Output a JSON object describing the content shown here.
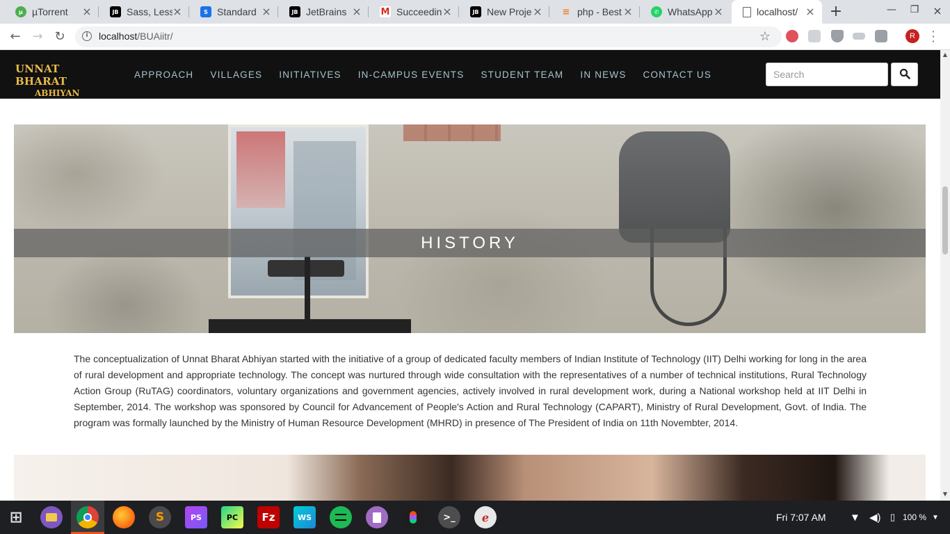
{
  "browser": {
    "tabs": [
      {
        "title": "µTorrent",
        "favicon": "utorrent-icon",
        "color": "#4caf50"
      },
      {
        "title": "Sass, Less",
        "favicon": "jetbrains-icon",
        "color": "#000000"
      },
      {
        "title": "Standard",
        "favicon": "stylelint-icon",
        "color": "#1a73e8"
      },
      {
        "title": "JetBrains",
        "favicon": "jetbrains-icon",
        "color": "#000000"
      },
      {
        "title": "Succeedin",
        "favicon": "gmail-icon",
        "color": "#d93025"
      },
      {
        "title": "New Proje",
        "favicon": "jetbrains-icon",
        "color": "#000000"
      },
      {
        "title": "php - Best",
        "favicon": "stackoverflow-icon",
        "color": "#f48024"
      },
      {
        "title": "WhatsApp",
        "favicon": "whatsapp-icon",
        "color": "#25d366"
      },
      {
        "title": "localhost/",
        "favicon": "page-icon",
        "color": "#ffffff"
      }
    ],
    "url_host": "localhost",
    "url_path": "/BUAiitr/",
    "profile_initial": "R"
  },
  "site": {
    "logo_line1": "UNNAT BHARAT",
    "logo_line2": "ABHIYAN",
    "nav": [
      "APPROACH",
      "VILLAGES",
      "INITIATIVES",
      "IN-CAMPUS EVENTS",
      "STUDENT TEAM",
      "IN NEWS",
      "CONTACT US"
    ],
    "search_placeholder": "Search"
  },
  "hero": {
    "title": "HISTORY"
  },
  "history_text": "The conceptualization of Unnat Bharat Abhiyan started with the initiative of a group of dedicated faculty members of Indian Institute of Technology (IIT) Delhi working for long in the area of rural development and appropriate technology. The concept was nurtured through wide consultation with the representatives of a number of technical institutions, Rural Technology Action Group (RuTAG) coordinators, voluntary organizations and government agencies, actively involved in rural development work, during a National workshop held at IIT Delhi in September, 2014. The workshop was sponsored by Council for Advancement of People's Action and Rural Technology (CAPART), Ministry of Rural Development, Govt. of India. The program was formally launched by the Ministry of Human Resource Development (MHRD) in presence of The President of India on 11th Novembter, 2014.",
  "taskbar": {
    "clock": "Fri  7:07 AM",
    "battery": "100 %",
    "apps": [
      "files",
      "chrome",
      "firefox",
      "sublime-text",
      "phpstorm",
      "pycharm",
      "filezilla",
      "webstorm",
      "spotify",
      "text-editor",
      "figma",
      "terminal",
      "evince"
    ]
  },
  "colors": {
    "nav_bg": "#111111",
    "nav_link": "#a6c3cc",
    "logo_gold": "#e9b949",
    "taskbar_bg": "#1e1f22",
    "accent_underline": "#e95420"
  }
}
